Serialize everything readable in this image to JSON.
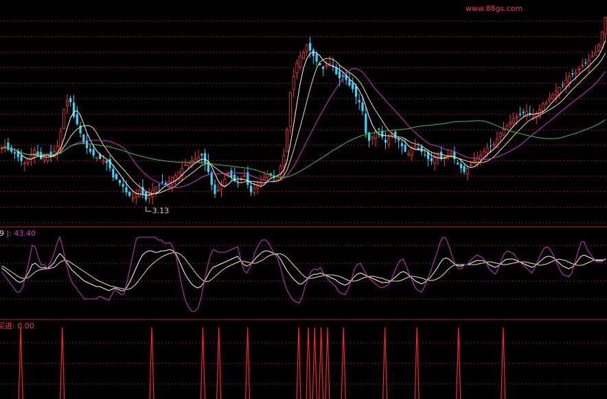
{
  "watermark": "www.88gs.com",
  "colors": {
    "bg": "#000000",
    "grid": "#8b1a1a",
    "panel_border": "#b01e1e",
    "candle_up": "#ff3333",
    "candle_down": "#33d6ff",
    "ma_fast": "#ffffff",
    "ma_mid": "#f0e68c",
    "ma_slow": "#cc33cc",
    "ma_long": "#33cc33",
    "k_line": "#ffffff",
    "d_line": "#f0e68c",
    "j_line": "#cc33cc",
    "signal": "#ff2020",
    "watermark": "#ff3333",
    "kdj_label": "#dddddd",
    "j_label": "#cc33cc",
    "signal_label": "#ff3333"
  },
  "chart_data": [
    {
      "type": "candlestick",
      "title": "",
      "annotations": [
        {
          "text": "3.13",
          "index": 44
        }
      ],
      "ma_series": [
        {
          "role": "ma_fast",
          "window": 5
        },
        {
          "role": "ma_mid",
          "window": 10
        },
        {
          "role": "ma_slow",
          "window": 20
        },
        {
          "role": "ma_long",
          "window": 60
        }
      ],
      "ylim": [
        2.85,
        5.25
      ],
      "close": [
        3.7,
        3.72,
        3.68,
        3.66,
        3.64,
        3.6,
        3.56,
        3.54,
        3.58,
        3.62,
        3.68,
        3.62,
        3.58,
        3.6,
        3.64,
        3.62,
        3.66,
        3.72,
        3.88,
        4.12,
        4.22,
        4.2,
        4.04,
        3.96,
        3.86,
        3.76,
        3.7,
        3.66,
        3.62,
        3.6,
        3.58,
        3.56,
        3.54,
        3.48,
        3.38,
        3.36,
        3.32,
        3.28,
        3.22,
        3.18,
        3.16,
        3.2,
        3.24,
        3.2,
        3.14,
        3.18,
        3.24,
        3.28,
        3.3,
        3.32,
        3.3,
        3.34,
        3.38,
        3.4,
        3.44,
        3.48,
        3.52,
        3.54,
        3.56,
        3.58,
        3.6,
        3.62,
        3.54,
        3.44,
        3.3,
        3.2,
        3.24,
        3.3,
        3.36,
        3.42,
        3.38,
        3.34,
        3.32,
        3.36,
        3.4,
        3.3,
        3.22,
        3.26,
        3.3,
        3.34,
        3.38,
        3.42,
        3.4,
        3.38,
        3.4,
        3.5,
        3.62,
        3.9,
        4.3,
        4.48,
        4.62,
        4.7,
        4.74,
        4.82,
        4.76,
        4.7,
        4.64,
        4.6,
        4.56,
        4.6,
        4.62,
        4.58,
        4.5,
        4.46,
        4.48,
        4.44,
        4.38,
        4.34,
        4.26,
        4.2,
        4.1,
        3.86,
        3.78,
        3.82,
        3.88,
        3.9,
        3.82,
        3.76,
        3.8,
        3.86,
        3.82,
        3.78,
        3.72,
        3.66,
        3.64,
        3.7,
        3.72,
        3.68,
        3.66,
        3.62,
        3.58,
        3.56,
        3.6,
        3.62,
        3.58,
        3.6,
        3.62,
        3.64,
        3.58,
        3.52,
        3.48,
        3.44,
        3.48,
        3.52,
        3.56,
        3.6,
        3.62,
        3.66,
        3.7,
        3.72,
        3.74,
        3.8,
        3.86,
        3.9,
        3.94,
        3.98,
        4.02,
        4.04,
        4.06,
        4.08,
        4.1,
        4.06,
        4.04,
        4.08,
        4.12,
        4.18,
        4.2,
        4.24,
        4.28,
        4.32,
        4.36,
        4.38,
        4.44,
        4.48,
        4.5,
        4.52,
        4.56,
        4.6,
        4.62,
        4.66,
        4.7,
        4.74,
        4.82,
        4.96,
        5.12
      ],
      "x_count": 190
    },
    {
      "type": "line",
      "title": "",
      "label_prefix": "9",
      "label_j": "J: 43.40",
      "series": [
        {
          "role": "k_line",
          "values": [
            55,
            52,
            48,
            44,
            40,
            36,
            34,
            36,
            42,
            50,
            60,
            62,
            58,
            55,
            56,
            54,
            58,
            62,
            70,
            76,
            72,
            65,
            58,
            52,
            48,
            44,
            40,
            36,
            34,
            32,
            30,
            28,
            28,
            26,
            24,
            22,
            24,
            26,
            24,
            22,
            22,
            28,
            36,
            46,
            56,
            66,
            74,
            78,
            80,
            80,
            78,
            78,
            80,
            80,
            81,
            82,
            80,
            75,
            65,
            55,
            45,
            38,
            32,
            28,
            26,
            28,
            34,
            42,
            50,
            56,
            58,
            60,
            62,
            64,
            66,
            68,
            70,
            72,
            66,
            60,
            58,
            60,
            64,
            70,
            74,
            78,
            80,
            80,
            78,
            76,
            74,
            68,
            60,
            52,
            46,
            40,
            36,
            32,
            32,
            36,
            40,
            44,
            46,
            46,
            48,
            46,
            44,
            42,
            40,
            38,
            34,
            32,
            30,
            32,
            36,
            42,
            46,
            48,
            46,
            44,
            42,
            40,
            38,
            36,
            34,
            34,
            34,
            36,
            40,
            44,
            48,
            50,
            48,
            44,
            40,
            36,
            34,
            32,
            34,
            38,
            42,
            48,
            54,
            62,
            68,
            70,
            68,
            64,
            60,
            58,
            58,
            60,
            60,
            62,
            64,
            66,
            66,
            66,
            64,
            60,
            58,
            56,
            58,
            62,
            66,
            68,
            68,
            68,
            66,
            64,
            62,
            60,
            58,
            56,
            58,
            62,
            66,
            70,
            72,
            72,
            70,
            66,
            62,
            58,
            56,
            54,
            56,
            60,
            66,
            72,
            74,
            72,
            70,
            68,
            66,
            66,
            66,
            68
          ]
        },
        {
          "role": "d_line",
          "values": [
            58,
            56,
            53,
            50,
            47,
            44,
            41,
            40,
            40,
            42,
            46,
            50,
            52,
            53,
            54,
            54,
            55,
            56,
            60,
            64,
            66,
            66,
            64,
            61,
            58,
            55,
            52,
            49,
            46,
            43,
            40,
            37,
            35,
            33,
            31,
            29,
            28,
            27,
            26,
            25,
            24,
            24,
            26,
            30,
            35,
            41,
            47,
            53,
            58,
            62,
            66,
            69,
            72,
            74,
            76,
            77,
            78,
            77,
            74,
            70,
            64,
            58,
            52,
            46,
            41,
            37,
            35,
            36,
            39,
            43,
            47,
            51,
            54,
            57,
            59,
            61,
            63,
            65,
            65,
            64,
            63,
            62,
            62,
            64,
            66,
            69,
            72,
            74,
            75,
            76,
            76,
            74,
            71,
            66,
            61,
            56,
            51,
            46,
            42,
            40,
            40,
            41,
            42,
            43,
            44,
            45,
            45,
            45,
            44,
            43,
            41,
            39,
            37,
            36,
            36,
            37,
            39,
            41,
            42,
            43,
            43,
            42,
            41,
            40,
            38,
            37,
            36,
            36,
            36,
            37,
            39,
            41,
            43,
            43,
            42,
            41,
            40,
            38,
            37,
            37,
            38,
            40,
            43,
            47,
            52,
            56,
            59,
            60,
            60,
            60,
            60,
            60,
            60,
            60,
            61,
            62,
            63,
            64,
            64,
            63,
            62,
            61,
            60,
            60,
            61,
            62,
            63,
            64,
            64,
            64,
            63,
            62,
            61,
            60,
            59,
            60,
            61,
            63,
            65,
            67,
            68,
            67,
            66,
            64,
            62,
            60,
            59,
            59,
            60,
            62,
            64,
            66,
            67,
            67,
            67,
            67
          ]
        },
        {
          "role": "j_line",
          "values": [
            50,
            44,
            38,
            32,
            26,
            20,
            20,
            28,
            46,
            66,
            88,
            86,
            70,
            59,
            60,
            54,
            64,
            74,
            90,
            100,
            84,
            63,
            46,
            34,
            28,
            22,
            16,
            10,
            10,
            10,
            10,
            10,
            14,
            12,
            10,
            8,
            16,
            24,
            20,
            16,
            18,
            36,
            56,
            78,
            98,
            100,
            100,
            100,
            100,
            100,
            100,
            96,
            96,
            92,
            91,
            92,
            84,
            71,
            47,
            25,
            7,
            -2,
            -8,
            -8,
            -4,
            10,
            32,
            54,
            72,
            82,
            80,
            78,
            78,
            78,
            80,
            82,
            84,
            86,
            68,
            52,
            48,
            56,
            68,
            82,
            90,
            96,
            96,
            92,
            84,
            76,
            70,
            56,
            38,
            24,
            16,
            8,
            6,
            4,
            12,
            28,
            40,
            50,
            54,
            52,
            56,
            48,
            42,
            36,
            32,
            28,
            20,
            18,
            16,
            24,
            36,
            52,
            60,
            62,
            54,
            46,
            40,
            36,
            32,
            28,
            26,
            28,
            30,
            36,
            48,
            58,
            66,
            68,
            58,
            46,
            36,
            26,
            22,
            20,
            28,
            40,
            50,
            64,
            76,
            92,
            100,
            98,
            86,
            72,
            60,
            54,
            54,
            60,
            60,
            66,
            70,
            74,
            72,
            70,
            64,
            54,
            50,
            46,
            54,
            66,
            76,
            80,
            78,
            76,
            70,
            64,
            60,
            56,
            52,
            48,
            56,
            66,
            76,
            84,
            86,
            82,
            74,
            64,
            54,
            46,
            44,
            42,
            48,
            62,
            78,
            92,
            94,
            82,
            76,
            70,
            64,
            64,
            64,
            70
          ]
        }
      ],
      "ylim": [
        -20,
        115
      ],
      "x_count": 190
    },
    {
      "type": "bar",
      "title": "",
      "label": "买进: 0.00",
      "signal_indices": [
        6,
        19,
        47,
        63,
        68,
        77,
        93,
        96,
        98,
        100,
        102,
        107,
        120,
        130,
        143,
        157
      ],
      "signal_value": 1,
      "ylim": [
        0,
        1.1
      ],
      "x_count": 190
    }
  ]
}
